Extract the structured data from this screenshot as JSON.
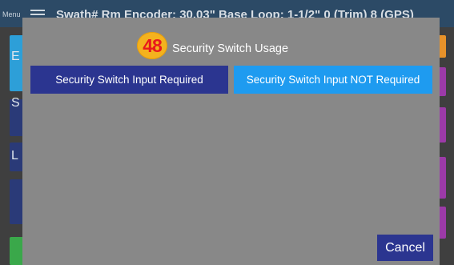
{
  "background_app": {
    "menu_label": "Menu",
    "title": "Swath# Rm Encoder: 30.03\" Base Loop: 1-1/2\" 0 (Trim) 8 (GPS)",
    "side_letters": [
      "E",
      "S",
      "L"
    ]
  },
  "dialog": {
    "step_badge": "48",
    "title": "Security Switch Usage",
    "option_required_label": "Security Switch Input Required",
    "option_not_required_label": "Security Switch Input NOT Required",
    "cancel_label": "Cancel"
  },
  "colors": {
    "selected_option": "#2b3590",
    "alternate_option": "#1e9bf0",
    "badge_fill": "#f4b21e",
    "badge_text": "#e8191c",
    "dialog_background": "#888888",
    "header_background": "#2c4a66"
  },
  "icons": {
    "menu": "hamburger-icon"
  }
}
